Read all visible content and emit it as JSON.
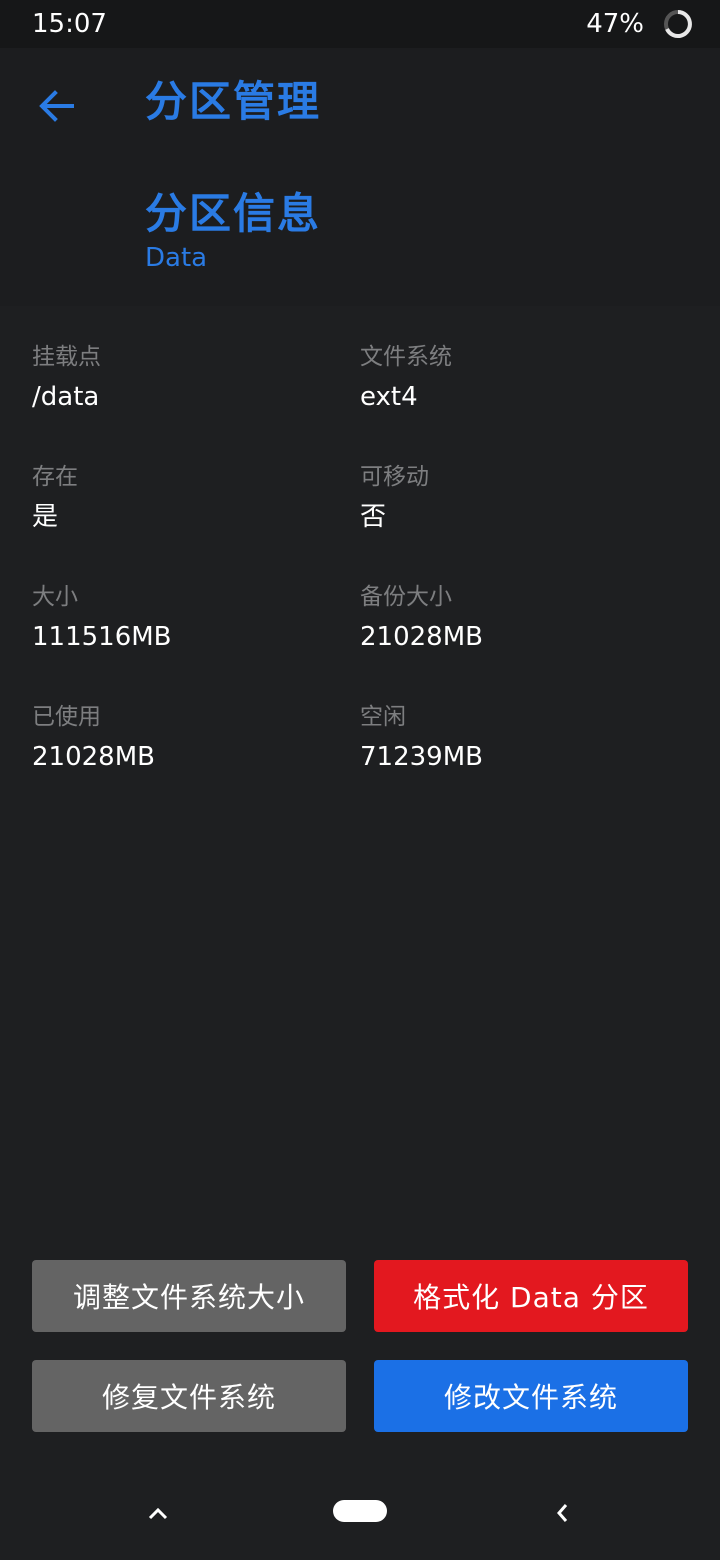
{
  "status_bar": {
    "time": "15:07",
    "battery": "47%",
    "icon": "loading-ring-icon"
  },
  "header": {
    "back_icon": "arrow-left-icon",
    "title": "分区管理",
    "section_title": "分区信息",
    "section_subtitle": "Data"
  },
  "info": [
    {
      "label": "挂载点",
      "value": "/data"
    },
    {
      "label": "文件系统",
      "value": "ext4"
    },
    {
      "label": "存在",
      "value": "是"
    },
    {
      "label": "可移动",
      "value": "否"
    },
    {
      "label": "大小",
      "value": "111516MB"
    },
    {
      "label": "备份大小",
      "value": "21028MB"
    },
    {
      "label": "已使用",
      "value": "21028MB"
    },
    {
      "label": "空闲",
      "value": "71239MB"
    }
  ],
  "buttons": {
    "resize": "调整文件系统大小",
    "format": "格式化 Data 分区",
    "repair": "修复文件系统",
    "change": "修改文件系统"
  },
  "nav": {
    "up_icon": "chevron-up-icon",
    "home_icon": "home-pill-icon",
    "back_icon": "chevron-left-icon"
  },
  "colors": {
    "accent": "#2a7be4",
    "background": "#1e1f21",
    "gray_button": "#646464",
    "red_button": "#e3181f",
    "blue_button": "#1b70e6"
  }
}
